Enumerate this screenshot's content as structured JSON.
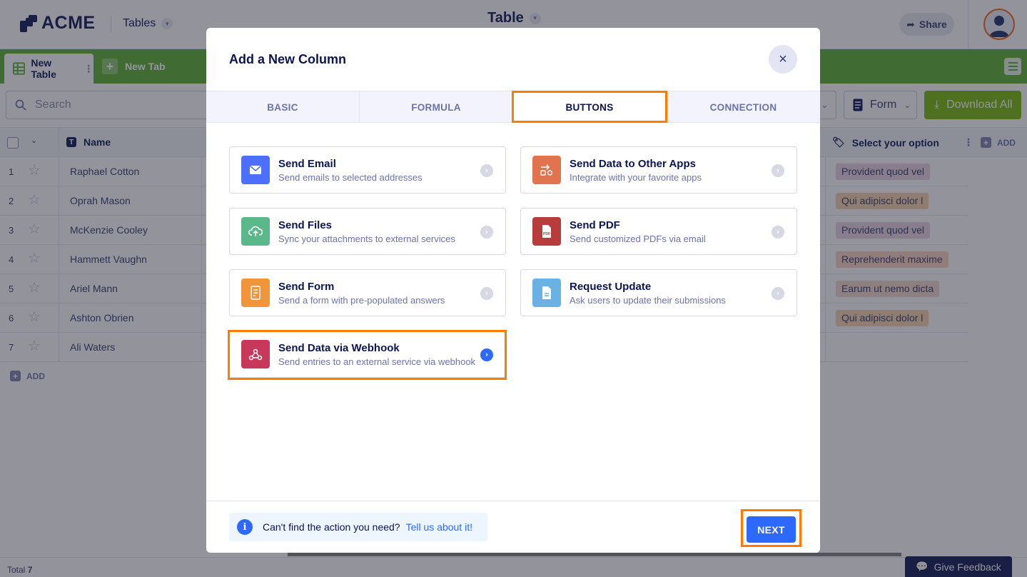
{
  "app": {
    "logo_text": "ACME",
    "switcher_label": "Tables",
    "center_title": "Table",
    "share_label": "Share"
  },
  "tabbar": {
    "active_tab": "New Table",
    "new_tab_label": "New Tab"
  },
  "toolbar": {
    "search_placeholder": "Search",
    "form_label": "Form",
    "download_label": "Download All"
  },
  "grid": {
    "name_header": "Name",
    "select_header": "Select your option",
    "add_column_label": "ADD",
    "add_row_label": "ADD",
    "rows": [
      {
        "num": "1",
        "name": "Raphael Cotton",
        "option": "Provident quod vel",
        "option_color": "#e9d3e1"
      },
      {
        "num": "2",
        "name": "Oprah Mason",
        "option": "Qui adipisci dolor l",
        "option_color": "#f6d2a8"
      },
      {
        "num": "3",
        "name": "McKenzie Cooley",
        "option": "Provident quod vel",
        "option_color": "#e9d3e1"
      },
      {
        "num": "4",
        "name": "Hammett Vaughn",
        "option": "Reprehenderit maxime",
        "option_color": "#ffd2c2"
      },
      {
        "num": "5",
        "name": "Ariel Mann",
        "option": "Earum ut nemo dicta",
        "option_color": "#f6d6cb"
      },
      {
        "num": "6",
        "name": "Ashton Obrien",
        "option": "Qui adipisci dolor l",
        "option_color": "#f6d2a8"
      },
      {
        "num": "7",
        "name": "Ali Waters",
        "option": "",
        "option_color": ""
      }
    ],
    "total_label": "Total",
    "total_value": "7"
  },
  "feedback_label": "Give Feedback",
  "modal": {
    "title": "Add a New Column",
    "tabs": [
      {
        "label": "BASIC",
        "active": false
      },
      {
        "label": "FORMULA",
        "active": false
      },
      {
        "label": "BUTTONS",
        "active": true
      },
      {
        "label": "CONNECTION",
        "active": false
      }
    ],
    "actions": [
      {
        "title": "Send Email",
        "subtitle": "Send emails to selected addresses",
        "color": "#4c6fff",
        "icon": "envelope-icon"
      },
      {
        "title": "Send Data to Other Apps",
        "subtitle": "Integrate with your favorite apps",
        "color": "#e1744e",
        "icon": "apps-icon"
      },
      {
        "title": "Send Files",
        "subtitle": "Sync your attachments to external services",
        "color": "#5ab88b",
        "icon": "cloud-upload-icon"
      },
      {
        "title": "Send PDF",
        "subtitle": "Send customized PDFs via email",
        "color": "#b83c3c",
        "icon": "pdf-icon"
      },
      {
        "title": "Send Form",
        "subtitle": "Send a form with pre-populated answers",
        "color": "#f0953c",
        "icon": "form-icon"
      },
      {
        "title": "Request Update",
        "subtitle": "Ask users to update their submissions",
        "color": "#6ab2e3",
        "icon": "document-icon"
      },
      {
        "title": "Send Data via Webhook",
        "subtitle": "Send entries to an external service via webhook",
        "color": "#c7385a",
        "icon": "webhook-icon"
      }
    ],
    "help_text": "Can't find the action you need?",
    "help_link": "Tell us about it!",
    "next_label": "NEXT"
  },
  "colors": {
    "accent": "#2e69ff",
    "highlight": "#ff7c00",
    "brand_green": "#5ab12f"
  }
}
